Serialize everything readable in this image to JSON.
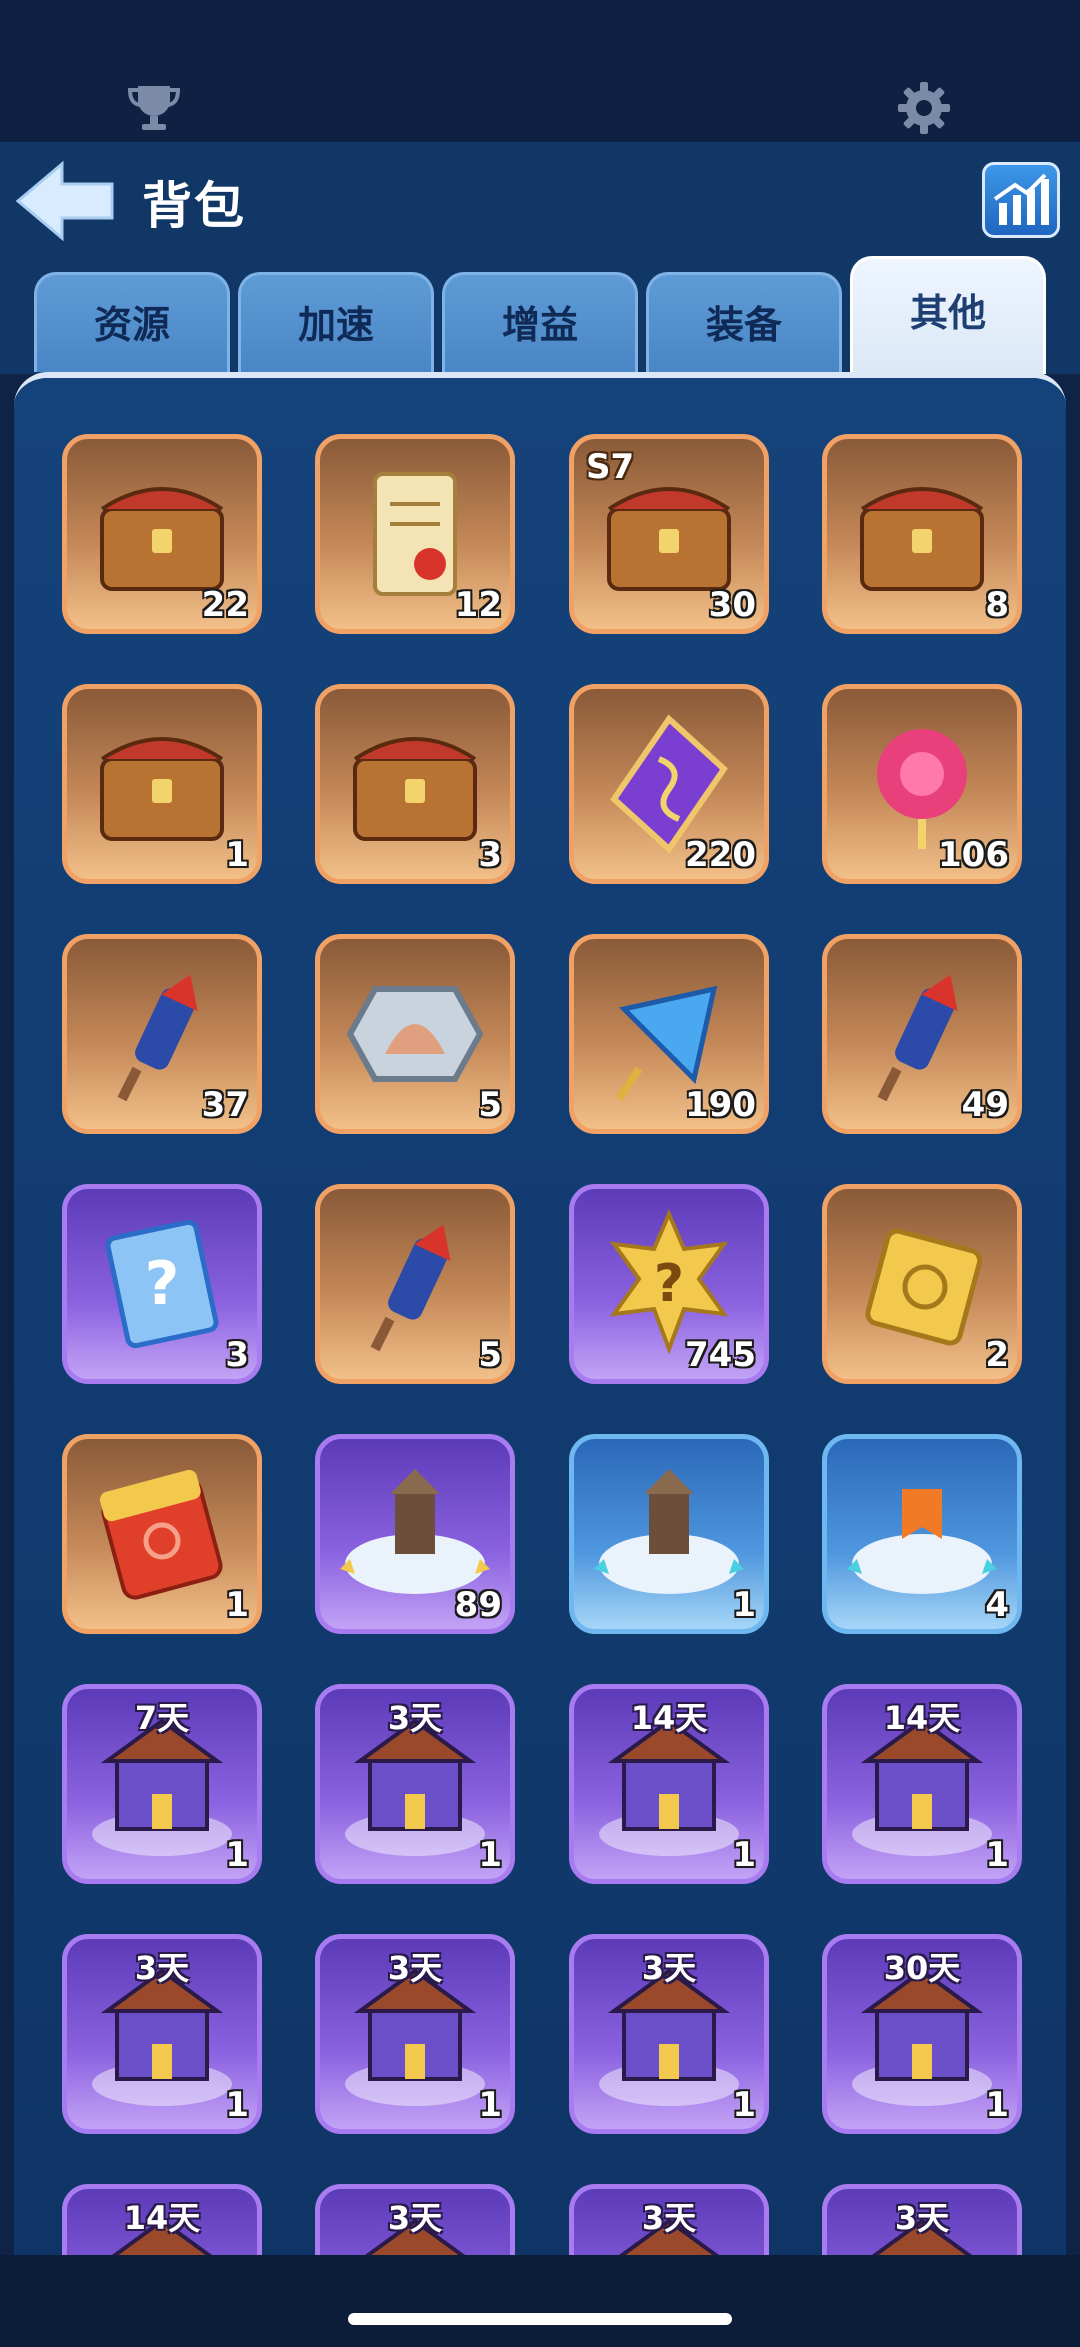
{
  "header": {
    "title": "背包",
    "back_icon": "back-arrow-icon",
    "stats_icon": "bar-chart-icon",
    "top_left_icon": "trophy-icon",
    "top_right_icon": "gear-icon"
  },
  "tabs": [
    {
      "label": "资源",
      "active": false
    },
    {
      "label": "加速",
      "active": false
    },
    {
      "label": "增益",
      "active": false
    },
    {
      "label": "装备",
      "active": false
    },
    {
      "label": "其他",
      "active": true
    }
  ],
  "items": [
    {
      "icon": "open-treasure-chest-icon",
      "rarity": "orange",
      "count": "22"
    },
    {
      "icon": "scroll-icon",
      "rarity": "orange",
      "count": "12"
    },
    {
      "icon": "season-chest-icon",
      "rarity": "orange",
      "count": "30",
      "season": "S7"
    },
    {
      "icon": "iron-chest-icon",
      "rarity": "orange",
      "count": "8"
    },
    {
      "icon": "rewards-chest-icon",
      "rarity": "orange",
      "count": "1"
    },
    {
      "icon": "wooden-chest-icon",
      "rarity": "orange",
      "count": "3"
    },
    {
      "icon": "purple-rune-icon",
      "rarity": "orange",
      "count": "220"
    },
    {
      "icon": "pink-rose-icon",
      "rarity": "orange",
      "count": "106"
    },
    {
      "icon": "firework-rocket-icon",
      "rarity": "orange",
      "count": "37"
    },
    {
      "icon": "shell-badge-icon",
      "rarity": "orange",
      "count": "5"
    },
    {
      "icon": "blue-crystal-icon",
      "rarity": "orange",
      "count": "190"
    },
    {
      "icon": "firework-rocket-blue-icon",
      "rarity": "orange",
      "count": "49"
    },
    {
      "icon": "mystery-card-icon",
      "rarity": "purple",
      "count": "3"
    },
    {
      "icon": "twin-rockets-icon",
      "rarity": "orange",
      "count": "5"
    },
    {
      "icon": "mystery-medal-icon",
      "rarity": "purple",
      "count": "745"
    },
    {
      "icon": "golden-ticket-icon",
      "rarity": "orange",
      "count": "2"
    },
    {
      "icon": "red-envelope-icon",
      "rarity": "orange",
      "count": "1"
    },
    {
      "icon": "relocate-castle-icon",
      "rarity": "purple",
      "count": "89"
    },
    {
      "icon": "relocate-tower-icon",
      "rarity": "blue",
      "count": "1"
    },
    {
      "icon": "relocate-banner-icon",
      "rarity": "blue",
      "count": "4"
    },
    {
      "icon": "dark-castle-skin-icon",
      "rarity": "purple",
      "count": "1",
      "days": "7天"
    },
    {
      "icon": "winter-house-skin-icon",
      "rarity": "purple",
      "count": "1",
      "days": "3天"
    },
    {
      "icon": "festival-palace-skin-icon",
      "rarity": "purple",
      "count": "1",
      "days": "14天"
    },
    {
      "icon": "snow-globe-skin-icon",
      "rarity": "purple",
      "count": "1",
      "days": "14天"
    },
    {
      "icon": "golden-ship-skin-icon",
      "rarity": "purple",
      "count": "1",
      "days": "3天"
    },
    {
      "icon": "ice-tower-skin-icon",
      "rarity": "purple",
      "count": "1",
      "days": "3天"
    },
    {
      "icon": "piano-castle-skin-icon",
      "rarity": "purple",
      "count": "1",
      "days": "3天"
    },
    {
      "icon": "jade-fortress-skin-icon",
      "rarity": "purple",
      "count": "1",
      "days": "30天"
    },
    {
      "icon": "fortress-skin-icon",
      "rarity": "purple",
      "count": "",
      "days": "14天"
    },
    {
      "icon": "castle-skin-icon",
      "rarity": "purple",
      "count": "",
      "days": "3天"
    },
    {
      "icon": "castle-skin-icon",
      "rarity": "purple",
      "count": "",
      "days": "3天"
    },
    {
      "icon": "castle-skin-icon",
      "rarity": "purple",
      "count": "",
      "days": "3天"
    }
  ]
}
